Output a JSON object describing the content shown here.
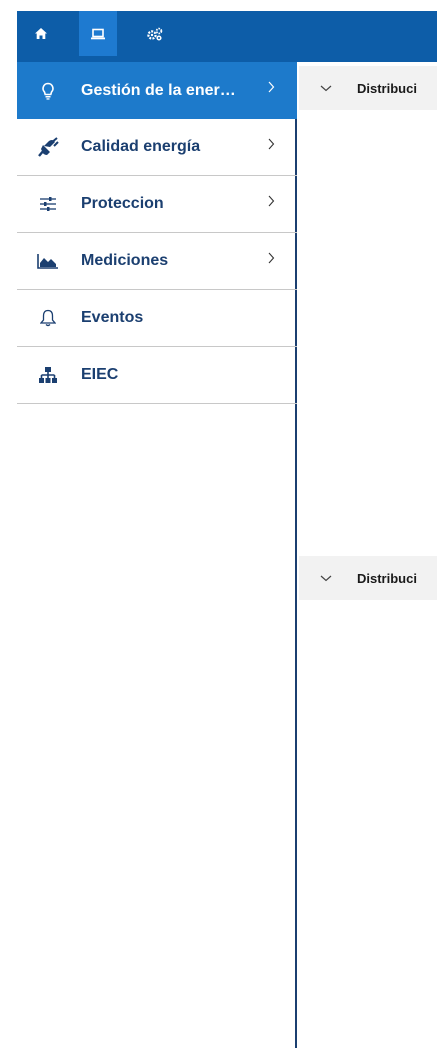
{
  "topbar": {
    "icons": [
      {
        "name": "home-icon"
      },
      {
        "name": "laptop-icon"
      },
      {
        "name": "gears-icon"
      }
    ]
  },
  "sidebar": {
    "items": [
      {
        "label": "Gestión de la ener…",
        "icon": "lightbulb-icon",
        "active": true,
        "has_chevron": true
      },
      {
        "label": "Calidad energía",
        "icon": "plug-icon",
        "active": false,
        "has_chevron": true
      },
      {
        "label": "Proteccion",
        "icon": "sliders-icon",
        "active": false,
        "has_chevron": true
      },
      {
        "label": "Mediciones",
        "icon": "area-chart-icon",
        "active": false,
        "has_chevron": true
      },
      {
        "label": "Eventos",
        "icon": "bell-icon",
        "active": false,
        "has_chevron": false
      },
      {
        "label": "EIEC",
        "icon": "hierarchy-icon",
        "active": false,
        "has_chevron": false
      }
    ]
  },
  "main": {
    "panels": [
      {
        "title": "Distribuci"
      },
      {
        "title": "Distribuci"
      }
    ]
  },
  "colors": {
    "topbar": "#0d5da8",
    "active_item": "#1d7acb",
    "label_text": "#1b3f70"
  }
}
